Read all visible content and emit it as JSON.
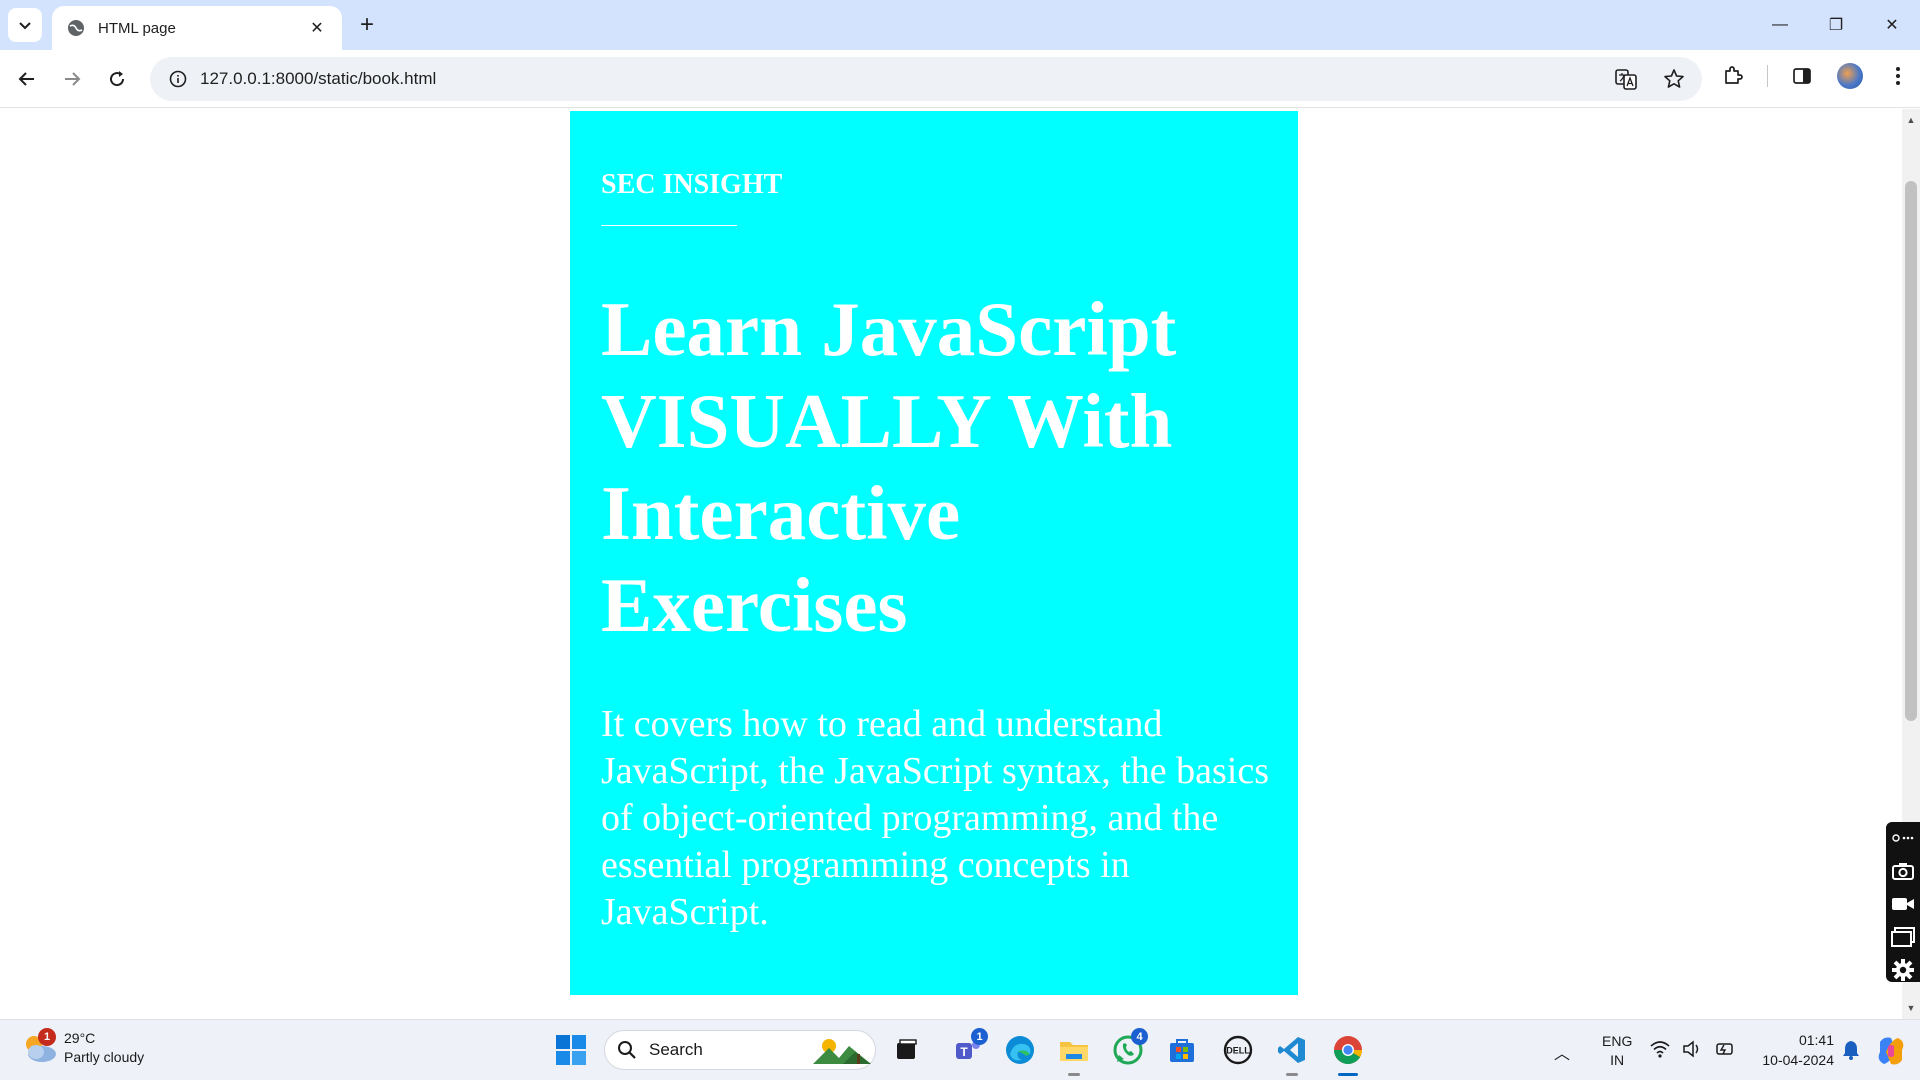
{
  "browser": {
    "tab": {
      "title": "HTML page",
      "close_glyph": "✕"
    },
    "new_tab_glyph": "+",
    "url": "127.0.0.1:8000/static/book.html",
    "window_controls": {
      "minimize": "—",
      "restore": "❐",
      "close": "✕"
    }
  },
  "book": {
    "brand": "SEC INSIGHT",
    "headline": "Learn JavaScript VISUALLY With Interactive Exercises",
    "description": "It covers how to read and understand JavaScript, the JavaScript syntax, the basics of object-oriented programming, and the essential programming concepts in JavaScript.",
    "background_color": "#00ffff",
    "text_color": "#ffffff"
  },
  "taskbar": {
    "weather": {
      "badge": "1",
      "temperature": "29°C",
      "condition": "Partly cloudy"
    },
    "search_label": "Search",
    "teams_badge": "1",
    "whatsapp_badge": "4",
    "language": {
      "line1": "ENG",
      "line2": "IN"
    },
    "clock": {
      "time": "01:41",
      "date": "10-04-2024"
    }
  }
}
